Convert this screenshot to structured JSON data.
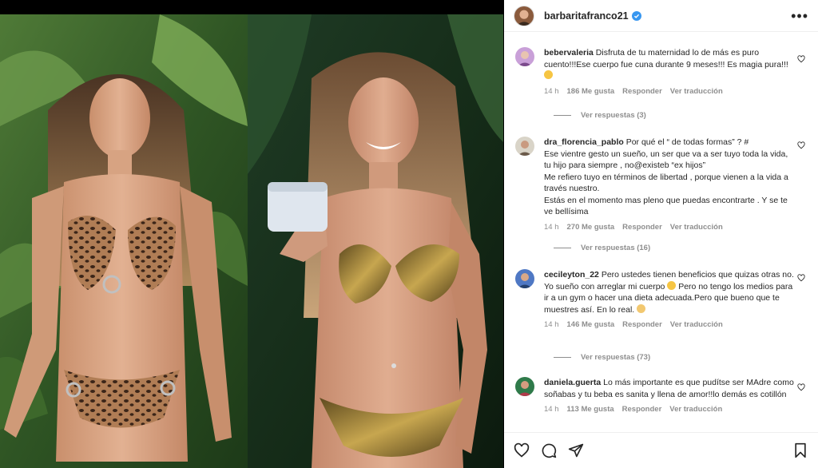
{
  "post": {
    "username": "barbaritafranco21",
    "verified": true,
    "more_label": "•••"
  },
  "comments": [
    {
      "username": "bebervaleria",
      "text": "Disfruta de tu maternidad lo de más es puro cuento!!!Ese cuerpo fue cuna durante 9 meses!!! Es magia pura!!!",
      "emoji": "heart-eyes-emoji",
      "time": "14 h",
      "likes": "186 Me gusta",
      "reply": "Responder",
      "translate": "Ver traducción",
      "view_replies": "Ver respuestas (3)"
    },
    {
      "username": "dra_florencia_pablo",
      "lines": [
        "Por qué el “ de todas formas” ? #",
        "Ese vientre gesto un sueño, un ser que va a ser tuyo toda la vida, tu hijo para siempre , no@existeb “ex hijos”",
        "Me refiero tuyo en términos de libertad , porque vienen a la vida a través nuestro.",
        "Estás en el momento mas pleno que puedas encontrarte . Y se te ve bellísima"
      ],
      "time": "14 h",
      "likes": "270 Me gusta",
      "reply": "Responder",
      "translate": "Ver traducción",
      "view_replies": "Ver respuestas (16)"
    },
    {
      "username": "cecileyton_22",
      "text_a": "Pero ustedes tienen beneficios que quizas otras no. Yo sueño con arreglar mi cuerpo",
      "text_b": "Pero no tengo los medios para ir a un gym o hacer una dieta adecuada.Pero que bueno que te muestres así. En lo real.",
      "emoji_a": "crying-emoji",
      "emoji_b": "clapping-emoji",
      "time": "14 h",
      "likes": "146 Me gusta",
      "reply": "Responder",
      "translate": "Ver traducción",
      "view_replies": "Ver respuestas (73)"
    },
    {
      "username": "daniela.guerta",
      "text": "Lo más importante es que pudítse ser MAdre como soñabas y tu beba es sanita y llena de amor!!lo demás es cotillón",
      "time": "14 h",
      "likes": "113 Me gusta",
      "reply": "Responder",
      "translate": "Ver traducción"
    }
  ],
  "actions": {
    "like_icon": "heart-outline-icon",
    "comment_icon": "comment-bubble-icon",
    "share_icon": "paper-plane-icon",
    "save_icon": "bookmark-icon"
  },
  "colors": {
    "text": "#262626",
    "muted": "#8e8e8e",
    "verified": "#3897f0",
    "divider": "#efefef"
  }
}
